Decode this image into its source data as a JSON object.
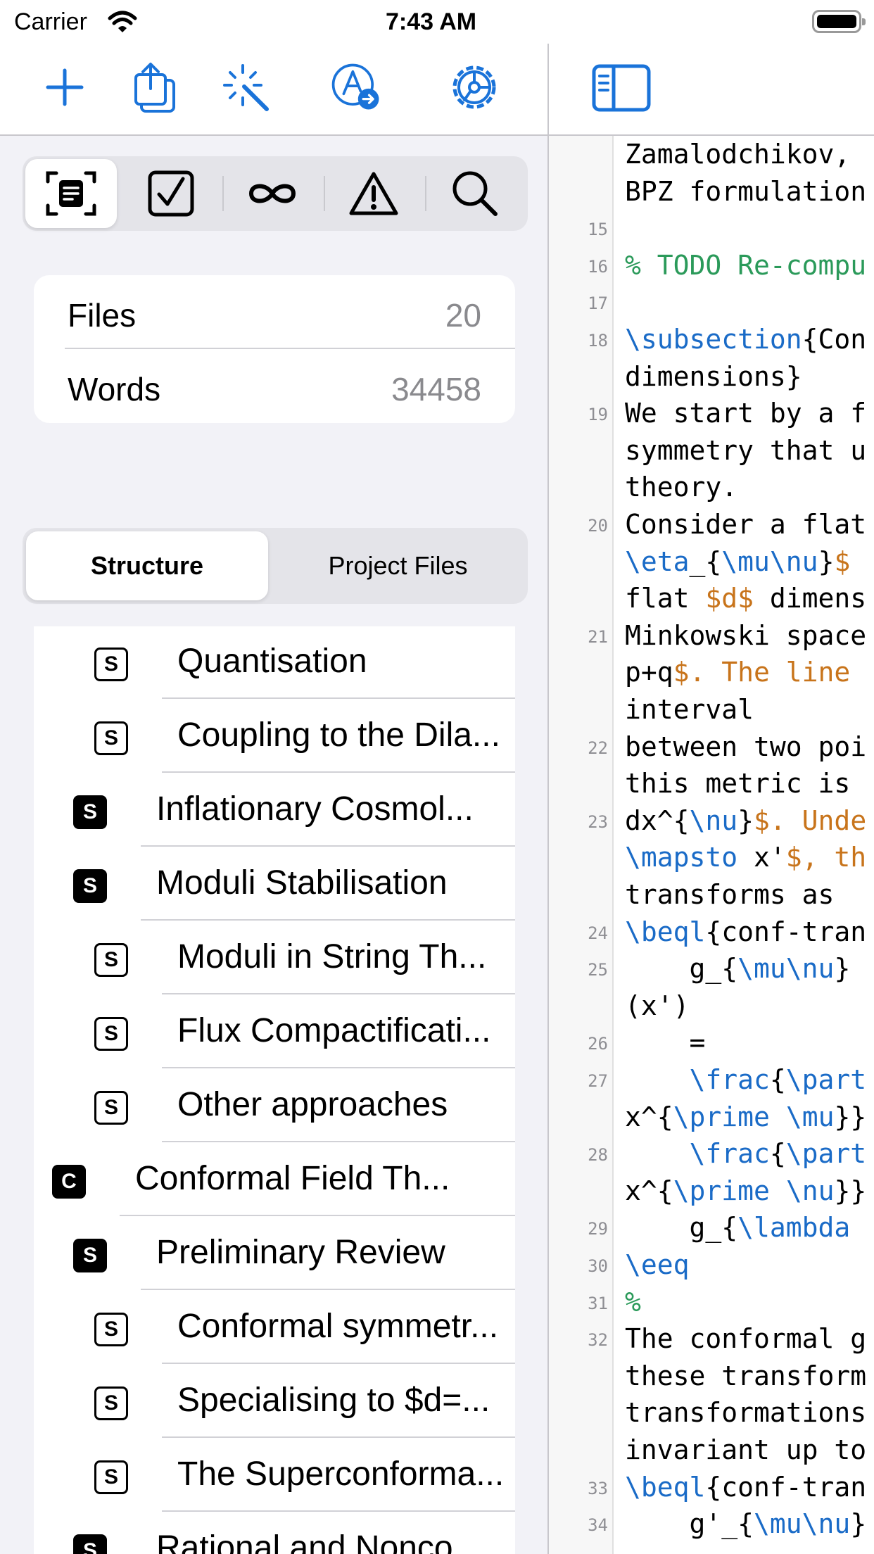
{
  "status_bar": {
    "carrier": "Carrier",
    "time": "7:43 AM"
  },
  "toolbar": {
    "buttons": [
      "plus-icon",
      "share-icon",
      "magic-wand-icon",
      "compile-icon",
      "settings-gear-icon"
    ],
    "right_button": "sidebar-toggle-icon"
  },
  "inspector_tabs": [
    "outline-icon",
    "checkmark-icon",
    "infinity-icon",
    "warning-icon",
    "search-icon"
  ],
  "stats": {
    "files_label": "Files",
    "files_value": "20",
    "words_label": "Words",
    "words_value": "34458"
  },
  "view_tabs": {
    "structure": "Structure",
    "project_files": "Project Files",
    "selected": "Structure"
  },
  "tree": [
    {
      "badge": "S",
      "level": "subsection",
      "label": "Quantisation"
    },
    {
      "badge": "S",
      "level": "subsection",
      "label": "Coupling to the Dila..."
    },
    {
      "badge": "S",
      "level": "section",
      "label": "Inflationary Cosmol..."
    },
    {
      "badge": "S",
      "level": "section",
      "label": "Moduli Stabilisation"
    },
    {
      "badge": "S",
      "level": "subsection",
      "label": "Moduli in String Th..."
    },
    {
      "badge": "S",
      "level": "subsection",
      "label": "Flux Compactificati..."
    },
    {
      "badge": "S",
      "level": "subsection",
      "label": "Other approaches"
    },
    {
      "badge": "C",
      "level": "chapter",
      "label": "Conformal Field Th..."
    },
    {
      "badge": "S",
      "level": "section",
      "label": "Preliminary Review"
    },
    {
      "badge": "S",
      "level": "subsection",
      "label": "Conformal symmetr..."
    },
    {
      "badge": "S",
      "level": "subsection",
      "label": "Specialising to $d=..."
    },
    {
      "badge": "S",
      "level": "subsection",
      "label": "The Superconforma..."
    },
    {
      "badge": "S",
      "level": "section",
      "label": "Rational and Nonco..."
    }
  ],
  "editor": {
    "lines": [
      {
        "n": "",
        "t": "Zamalodchikov,"
      },
      {
        "n": "",
        "t": "BPZ formulation"
      },
      {
        "n": "15",
        "t": ""
      },
      {
        "n": "16",
        "t": "% TODO Re-compu"
      },
      {
        "n": "17",
        "t": ""
      },
      {
        "n": "18",
        "t": "\\subsection{Con"
      },
      {
        "n": "",
        "t": "dimensions}"
      },
      {
        "n": "19",
        "t": "We start by a f"
      },
      {
        "n": "",
        "t": "symmetry that u"
      },
      {
        "n": "",
        "t": "theory."
      },
      {
        "n": "20",
        "t": "Consider a flat"
      },
      {
        "n": "",
        "t": "\\eta_{\\mu\\nu}$"
      },
      {
        "n": "",
        "t": "flat $d$ dimens"
      },
      {
        "n": "21",
        "t": "Minkowski space"
      },
      {
        "n": "",
        "t": "p+q$. The line"
      },
      {
        "n": "",
        "t": "interval"
      },
      {
        "n": "22",
        "t": "between two poi"
      },
      {
        "n": "",
        "t": "this metric is"
      },
      {
        "n": "23",
        "t": "dx^{\\nu}$. Unde"
      },
      {
        "n": "",
        "t": "\\mapsto x'$, th"
      },
      {
        "n": "",
        "t": "transforms as"
      },
      {
        "n": "24",
        "t": "\\beql{conf-tran"
      },
      {
        "n": "25",
        "t": "    g_{\\mu\\nu}"
      },
      {
        "n": "",
        "t": "(x')"
      },
      {
        "n": "26",
        "t": "    ="
      },
      {
        "n": "27",
        "t": "    \\frac{\\part"
      },
      {
        "n": "",
        "t": "x^{\\prime \\mu}}"
      },
      {
        "n": "28",
        "t": "    \\frac{\\part"
      },
      {
        "n": "",
        "t": "x^{\\prime \\nu}}"
      },
      {
        "n": "29",
        "t": "    g_{\\lambda"
      },
      {
        "n": "30",
        "t": "\\eeq"
      },
      {
        "n": "31",
        "t": "%"
      },
      {
        "n": "32",
        "t": "The conformal g"
      },
      {
        "n": "",
        "t": "these transform"
      },
      {
        "n": "",
        "t": "transformations"
      },
      {
        "n": "",
        "t": "invariant up to"
      },
      {
        "n": "33",
        "t": "\\beql{conf-tran"
      },
      {
        "n": "34",
        "t": "    g'_{\\mu\\nu}"
      }
    ]
  },
  "colors": {
    "accent": "#1a73d9",
    "latex_command": "#1a6bc7",
    "math": "#c8741b",
    "comment": "#2b9a5a"
  }
}
